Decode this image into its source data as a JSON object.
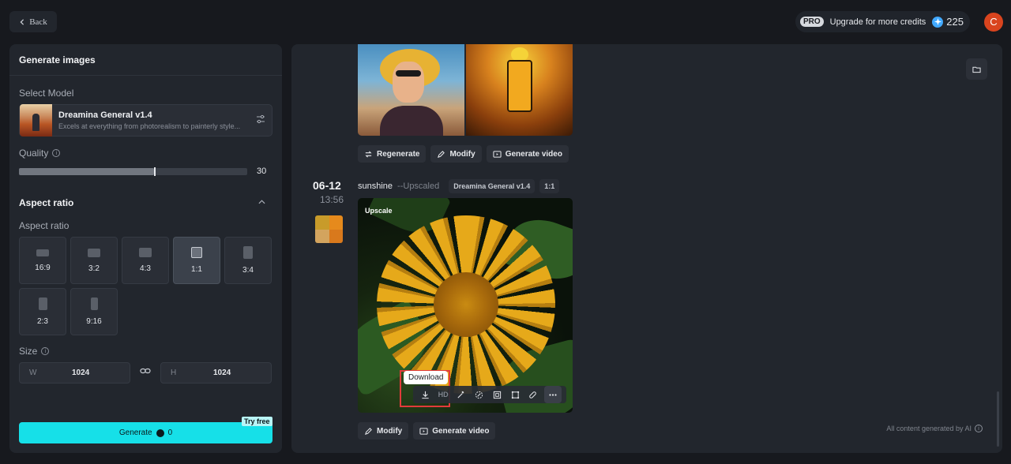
{
  "topbar": {
    "back_label": "Back",
    "pro_badge": "PRO",
    "upgrade_label": "Upgrade for more credits",
    "credits": "225",
    "avatar_initial": "C"
  },
  "left": {
    "title": "Generate images",
    "select_model_label": "Select Model",
    "model": {
      "name": "Dreamina General v1.4",
      "description": "Excels at everything from photorealism to painterly style..."
    },
    "quality": {
      "label": "Quality",
      "value": "30",
      "fill_fraction": 0.59
    },
    "aspect_heading": "Aspect ratio",
    "aspect_label": "Aspect ratio",
    "aspect_ratios": [
      {
        "label": "16:9",
        "selected": false
      },
      {
        "label": "3:2",
        "selected": false
      },
      {
        "label": "4:3",
        "selected": false
      },
      {
        "label": "1:1",
        "selected": true
      },
      {
        "label": "3:4",
        "selected": false
      },
      {
        "label": "2:3",
        "selected": false
      },
      {
        "label": "9:16",
        "selected": false
      }
    ],
    "size": {
      "label": "Size",
      "w_key": "W",
      "w_value": "1024",
      "h_key": "H",
      "h_value": "1024"
    },
    "generate": {
      "label": "Generate",
      "cost": "0",
      "try_free": "Try free"
    }
  },
  "right": {
    "top_actions": [
      "Regenerate",
      "Modify",
      "Generate video"
    ],
    "entry": {
      "date": "06-12",
      "time": "13:56",
      "prompt": "sunshine",
      "prompt_suffix": "--Upscaled",
      "model_tag": "Dreamina General v1.4",
      "ratio_tag": "1:1",
      "image_label": "Upscale",
      "tooltip": "Download",
      "toolbar_hd": "HD",
      "bottom_actions": [
        "Modify",
        "Generate video"
      ]
    },
    "footer_note": "All content generated by AI"
  },
  "colors": {
    "accent": "#16e0e8",
    "avatar": "#d9441e",
    "highlight": "#e23b3b"
  }
}
